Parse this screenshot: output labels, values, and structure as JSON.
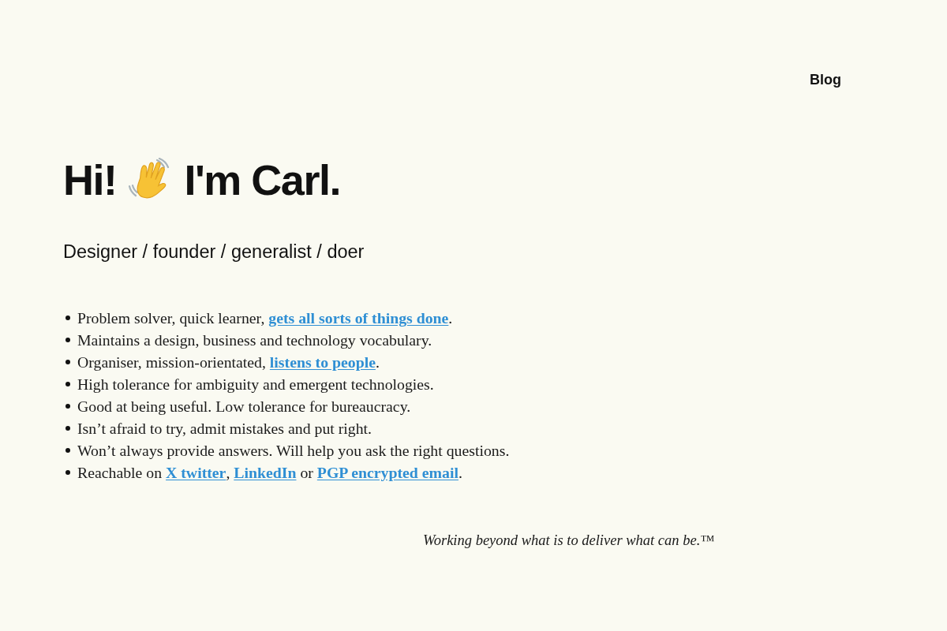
{
  "nav": {
    "links": [
      {
        "label": "Blog"
      }
    ]
  },
  "hero": {
    "greeting": "Hi!",
    "name": "I'm Carl.",
    "tagline": "Designer / founder / generalist / doer"
  },
  "traits": [
    {
      "segments": [
        {
          "kind": "text",
          "text": "Problem solver, quick learner, "
        },
        {
          "kind": "link",
          "text": "gets all sorts of things done"
        },
        {
          "kind": "text",
          "text": "."
        }
      ]
    },
    {
      "segments": [
        {
          "kind": "text",
          "text": "Maintains a design, business and technology vocabulary."
        }
      ]
    },
    {
      "segments": [
        {
          "kind": "text",
          "text": "Organiser, mission-orientated, "
        },
        {
          "kind": "link",
          "text": "listens to people"
        },
        {
          "kind": "text",
          "text": "."
        }
      ]
    },
    {
      "segments": [
        {
          "kind": "text",
          "text": "High tolerance for ambiguity and emergent technologies."
        }
      ]
    },
    {
      "segments": [
        {
          "kind": "text",
          "text": "Good at being useful. Low tolerance for bureaucracy."
        }
      ]
    },
    {
      "segments": [
        {
          "kind": "text",
          "text": "Isn’t afraid to try, admit mistakes and put right."
        }
      ]
    },
    {
      "segments": [
        {
          "kind": "text",
          "text": "Won’t always provide answers. Will help you ask the right questions."
        }
      ]
    },
    {
      "segments": [
        {
          "kind": "text",
          "text": "Reachable on "
        },
        {
          "kind": "link",
          "text": "X twitter"
        },
        {
          "kind": "text",
          "text": ", "
        },
        {
          "kind": "link",
          "text": "LinkedIn"
        },
        {
          "kind": "text",
          "text": " or "
        },
        {
          "kind": "link",
          "text": "PGP encrypted email"
        },
        {
          "kind": "text",
          "text": "."
        }
      ]
    }
  ],
  "footer": {
    "motto": "Working beyond what is to deliver what can be.™"
  }
}
